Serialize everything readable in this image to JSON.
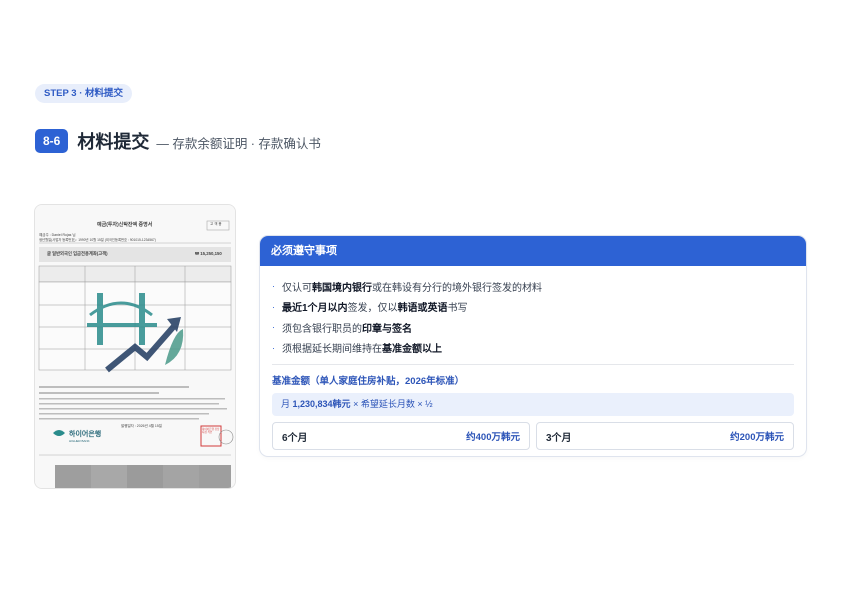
{
  "step_pill": "STEP 3 · 材料提交",
  "section": {
    "number": "8-6",
    "title": "材料提交",
    "subtitle": "— 存款余额证明 · 存款确认书"
  },
  "document": {
    "header_title": "예금(투자)신탁잔액 증명서",
    "header_id": "고 객 용",
    "holder_line": "예금주 : Daniel Rojas 님",
    "birth_line": "생년월일(사업자 등록번호) : 1990년 10월 15일 (외국인등록번호 : 901015-1234567)",
    "account_type": "글 일반외국인 입금전용계좌(고객)",
    "balance": "₩ 15,250,150",
    "bank_name": "하이어은행",
    "bank_sub": "HIGHER BANK",
    "issue_date": "발행일자 : 2026년 4월 15일",
    "stamp": "하이어은행 강남지점 직인"
  },
  "notice": {
    "header": "必须遵守事项",
    "rules": [
      {
        "pre": "仅认可 ",
        "b1": "韩国境内银行",
        "mid": " 或在韩设有分行的境外银行签发的材料",
        "b2": "",
        "post": ""
      },
      {
        "pre": "",
        "b1": "最近1个月以内",
        "mid": " 签发，仅以 ",
        "b2": "韩语或英语",
        "post": " 书写"
      },
      {
        "pre": "须包含银行职员的 ",
        "b1": "印章与签名",
        "mid": "",
        "b2": "",
        "post": ""
      },
      {
        "pre": "须根据延长期间维持在 ",
        "b1": "基准金额以上",
        "mid": "",
        "b2": "",
        "post": ""
      }
    ],
    "basis_title": "基准金额（单人家庭住房补贴，2026年标准）",
    "formula": {
      "pre": "月 ",
      "amount": "1,230,834韩元",
      "post": " × 希望延长月数 × ½"
    },
    "options": [
      {
        "months": "6个月",
        "amount": "约400万韩元"
      },
      {
        "months": "3个月",
        "amount": "约200万韩元"
      }
    ]
  },
  "colors": {
    "accent": "#2d62d4",
    "pill_bg": "#e8eefb",
    "formula_bg": "#eaf0fc"
  }
}
